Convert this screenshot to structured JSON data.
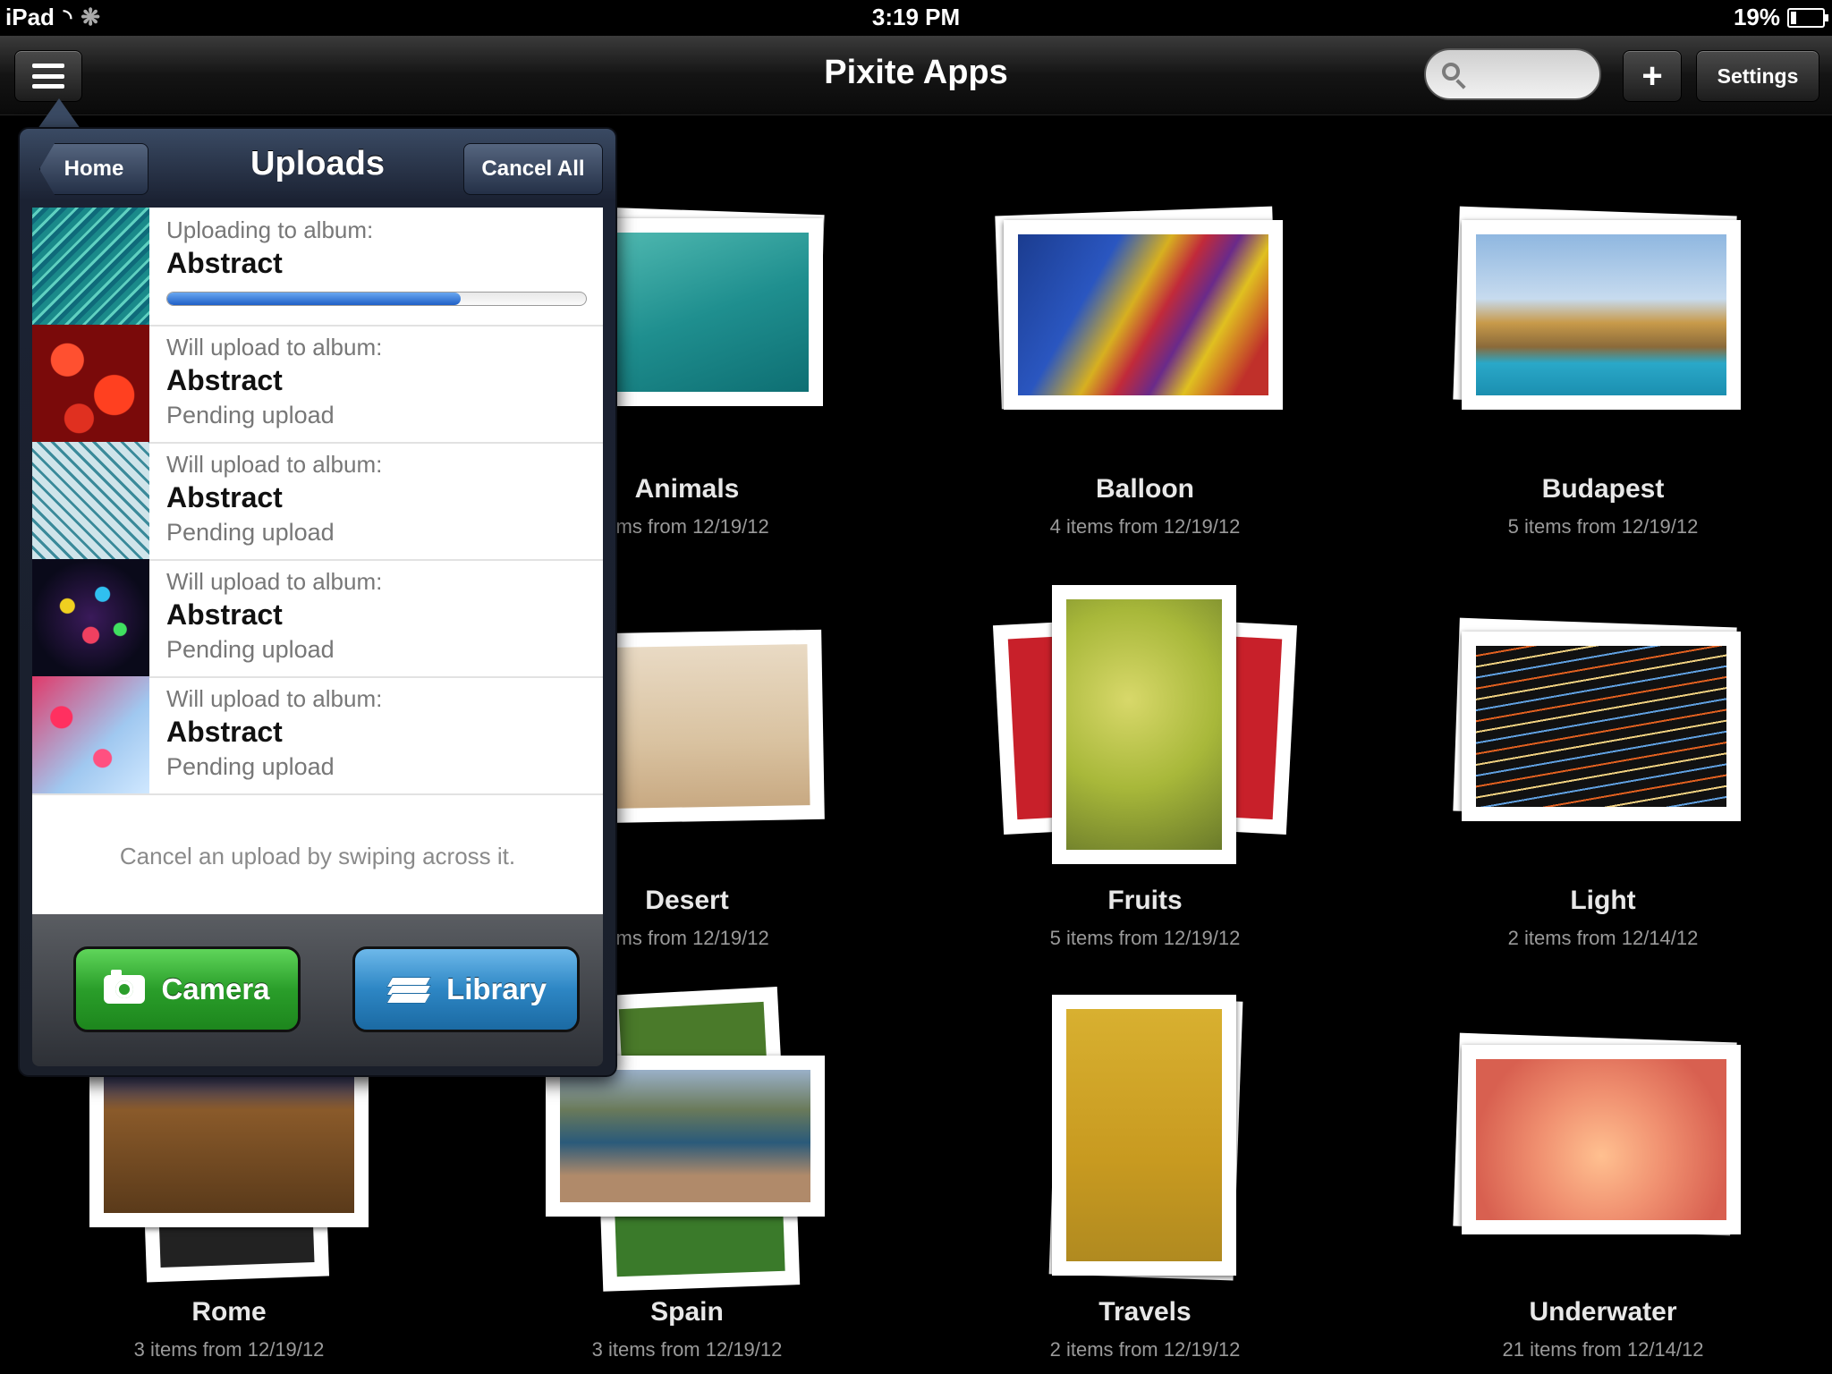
{
  "status_bar": {
    "device": "iPad",
    "time": "3:19 PM",
    "battery": "19%",
    "battery_level": 0.19
  },
  "nav_bar": {
    "title": "Pixite Apps",
    "search_placeholder": "",
    "add_label": "+",
    "settings_label": "Settings"
  },
  "popover": {
    "back_label": "Home",
    "title": "Uploads",
    "cancel_all_label": "Cancel All",
    "uploads": [
      {
        "line1": "Uploading to album:",
        "album": "Abstract",
        "progress": 0.7,
        "status": ""
      },
      {
        "line1": "Will upload to album:",
        "album": "Abstract",
        "status": "Pending upload"
      },
      {
        "line1": "Will upload to album:",
        "album": "Abstract",
        "status": "Pending upload"
      },
      {
        "line1": "Will upload to album:",
        "album": "Abstract",
        "status": "Pending upload"
      },
      {
        "line1": "Will upload to album:",
        "album": "Abstract",
        "status": "Pending upload"
      }
    ],
    "hint": "Cancel an upload by swiping across it.",
    "camera_label": "Camera",
    "library_label": "Library"
  },
  "albums": [
    {
      "name": "Animals",
      "sub": "ems from 12/19/12"
    },
    {
      "name": "Balloon",
      "sub": "4 items from 12/19/12"
    },
    {
      "name": "Budapest",
      "sub": "5 items from 12/19/12"
    },
    {
      "name": "Desert",
      "sub": "ems from 12/19/12"
    },
    {
      "name": "Fruits",
      "sub": "5 items from 12/19/12"
    },
    {
      "name": "Light",
      "sub": "2 items from 12/14/12"
    },
    {
      "name": "Rome",
      "sub": "3 items from 12/19/12"
    },
    {
      "name": "Spain",
      "sub": "3 items from 12/19/12"
    },
    {
      "name": "Travels",
      "sub": "2 items from 12/19/12"
    },
    {
      "name": "Underwater",
      "sub": "21 items from 12/14/12"
    }
  ]
}
